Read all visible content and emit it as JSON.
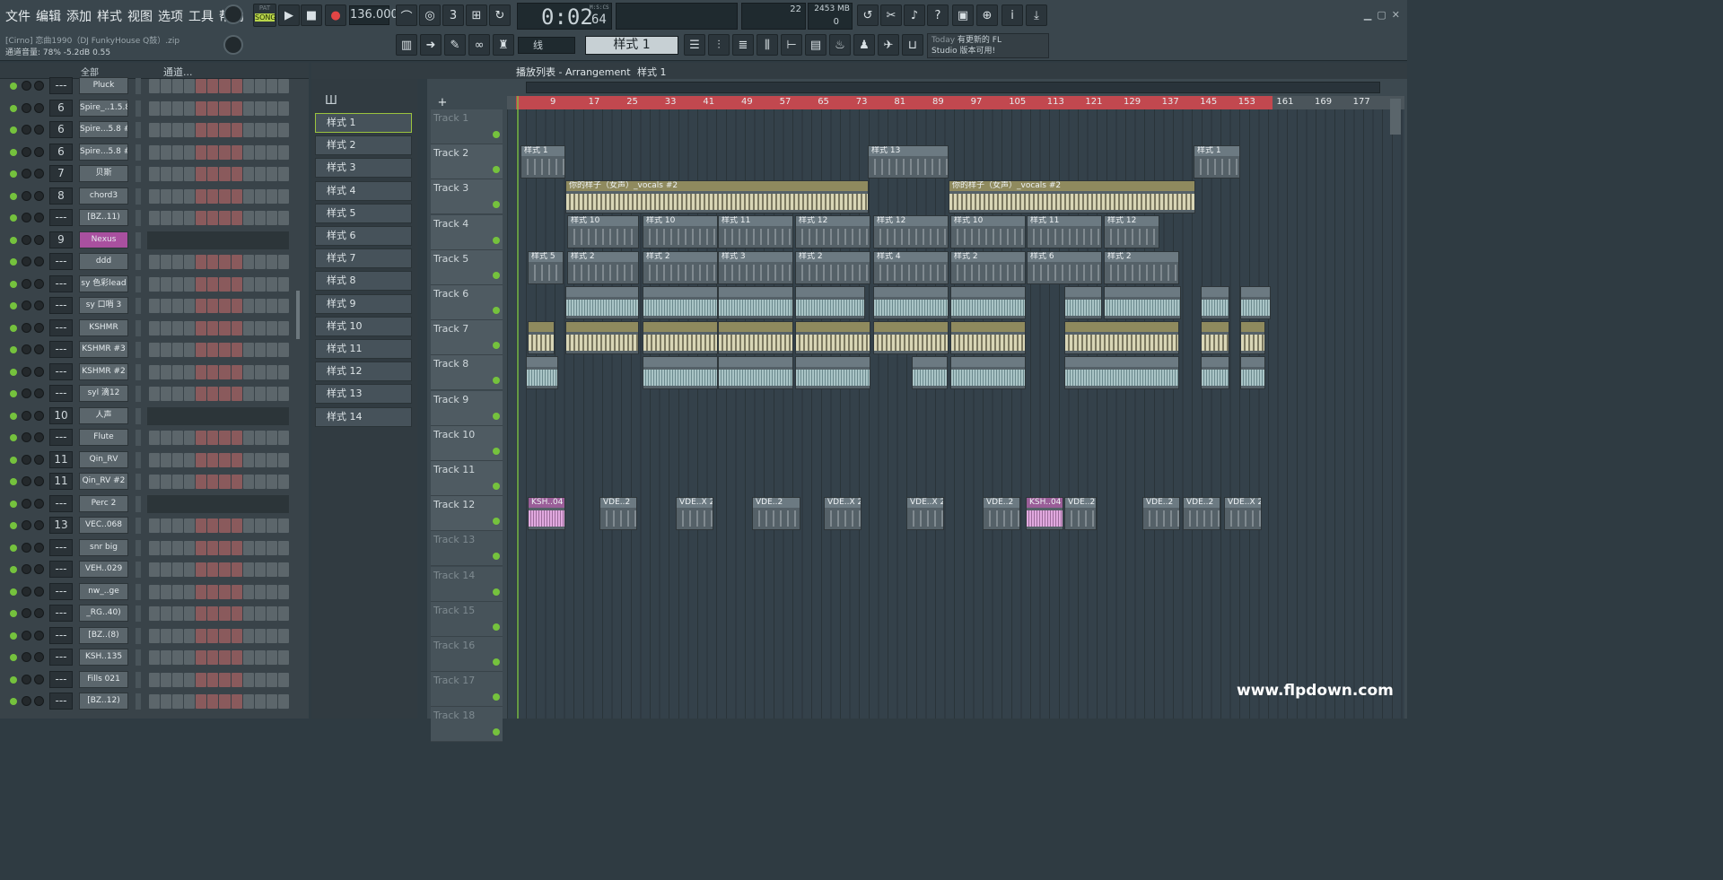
{
  "menu": [
    "文件",
    "编辑",
    "添加",
    "样式",
    "视图",
    "选项",
    "工具",
    "帮助"
  ],
  "transport": {
    "mode_pat": "PAT",
    "mode_song": "SONG",
    "tempo": "136.000",
    "time": "0:02",
    "time_sub": "64",
    "time_unit": "M:S:CS",
    "cpu": "22",
    "memory": "2453 MB",
    "poly": "0"
  },
  "project": {
    "file": "[Cirno] 恋曲1990（DJ FunkyHouse Q鼓）.zip",
    "volume": "通道音量: 78%  -5.2dB  0.55"
  },
  "snap": "线",
  "pattern_select": "样式 1",
  "news": {
    "title": "Today",
    "line1": "有更新的 FL",
    "line2": "Studio 版本可用!"
  },
  "channel_rack": {
    "filter": "全部",
    "label": "通道...",
    "channels": [
      {
        "num": "---",
        "name": "Pluck"
      },
      {
        "num": "6",
        "name": "Spire_..1.5.8"
      },
      {
        "num": "6",
        "name": "Spire...5.8 #2"
      },
      {
        "num": "6",
        "name": "Spire...5.8 #3"
      },
      {
        "num": "7",
        "name": "贝斯"
      },
      {
        "num": "8",
        "name": "chord3"
      },
      {
        "num": "---",
        "name": "[BZ..11)"
      },
      {
        "num": "9",
        "name": "Nexus"
      },
      {
        "num": "---",
        "name": "ddd"
      },
      {
        "num": "---",
        "name": "sy 色彩lead"
      },
      {
        "num": "---",
        "name": "sy 口哨 3"
      },
      {
        "num": "---",
        "name": "KSHMR"
      },
      {
        "num": "---",
        "name": "KSHMR #3"
      },
      {
        "num": "---",
        "name": "KSHMR #2"
      },
      {
        "num": "---",
        "name": "syl 滴12"
      },
      {
        "num": "10",
        "name": "人声"
      },
      {
        "num": "---",
        "name": "Flute"
      },
      {
        "num": "11",
        "name": "Qin_RV"
      },
      {
        "num": "11",
        "name": "Qin_RV #2"
      },
      {
        "num": "---",
        "name": "Perc 2"
      },
      {
        "num": "13",
        "name": "VEC..068"
      },
      {
        "num": "---",
        "name": "snr big"
      },
      {
        "num": "---",
        "name": "VEH..029"
      },
      {
        "num": "---",
        "name": "nw_..ge"
      },
      {
        "num": "---",
        "name": "_RG..40)"
      },
      {
        "num": "---",
        "name": "[BZ..(8)"
      },
      {
        "num": "---",
        "name": "KSH..135"
      },
      {
        "num": "---",
        "name": "Fills 021"
      },
      {
        "num": "---",
        "name": "[BZ..12)"
      }
    ]
  },
  "patterns": [
    "样式 1",
    "样式 2",
    "样式 3",
    "样式 4",
    "样式 5",
    "样式 6",
    "样式 7",
    "样式 8",
    "样式 9",
    "样式 10",
    "样式 11",
    "样式 12",
    "样式 13",
    "样式 14"
  ],
  "playlist": {
    "title": "播放列表 - Arrangement",
    "crumb": "样式 1",
    "bars": [
      "9",
      "17",
      "25",
      "33",
      "41",
      "49",
      "57",
      "65",
      "73",
      "81",
      "89",
      "97",
      "105",
      "113",
      "121",
      "129",
      "137",
      "145",
      "153",
      "161",
      "169",
      "177"
    ],
    "tracks": [
      "Track 1",
      "Track 2",
      "Track 3",
      "Track 4",
      "Track 5",
      "Track 6",
      "Track 7",
      "Track 8",
      "Track 9",
      "Track 10",
      "Track 11",
      "Track 12",
      "Track 13",
      "Track 14",
      "Track 15",
      "Track 16",
      "Track 17",
      "Track 18"
    ],
    "clip_labels": {
      "p1": "样式 1",
      "p13": "样式 13",
      "vocals": "你的样子（女声）_vocals #2",
      "p10": "样式 10",
      "p11": "样式 11",
      "p12": "样式 12",
      "p2": "样式 2",
      "p3": "样式 3",
      "p4": "样式 4",
      "p5": "样式 5",
      "p6": "样式 6",
      "ksh": "KSH..04",
      "vde": "VDE..2",
      "vdex": "VDE..X 2"
    }
  },
  "watermark": "www.flpdown.com"
}
